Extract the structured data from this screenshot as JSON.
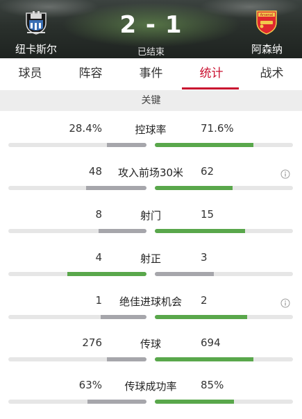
{
  "match": {
    "home_team": "纽卡斯尔",
    "away_team": "阿森纳",
    "score": "2 - 1",
    "status": "已结束",
    "home_crest_icon": "newcastle-crest-icon",
    "away_crest_icon": "arsenal-crest-icon",
    "away_crest_text": "Arsenal"
  },
  "tabs": [
    {
      "label": "球员",
      "active": false
    },
    {
      "label": "阵容",
      "active": false
    },
    {
      "label": "事件",
      "active": false
    },
    {
      "label": "统计",
      "active": true
    },
    {
      "label": "战术",
      "active": false
    }
  ],
  "section": {
    "title": "关键"
  },
  "colors": {
    "accent": "#c9102f",
    "bar_leading": "#59a74b",
    "bar_trailing": "#a6a6ab",
    "bar_track": "#e6e6e6"
  },
  "stats": [
    {
      "label": "控球率",
      "home": "28.4%",
      "away": "71.6%",
      "home_share": 0.284,
      "away_share": 0.716,
      "leader": "away",
      "info": false
    },
    {
      "label": "攻入前场30米",
      "home": "48",
      "away": "62",
      "home_share": 0.436,
      "away_share": 0.564,
      "leader": "away",
      "info": true
    },
    {
      "label": "射门",
      "home": "8",
      "away": "15",
      "home_share": 0.348,
      "away_share": 0.652,
      "leader": "away",
      "info": false
    },
    {
      "label": "射正",
      "home": "4",
      "away": "3",
      "home_share": 0.571,
      "away_share": 0.429,
      "leader": "home",
      "info": false
    },
    {
      "label": "绝佳进球机会",
      "home": "1",
      "away": "2",
      "home_share": 0.333,
      "away_share": 0.667,
      "leader": "away",
      "info": true
    },
    {
      "label": "传球",
      "home": "276",
      "away": "694",
      "home_share": 0.285,
      "away_share": 0.715,
      "leader": "away",
      "info": false
    },
    {
      "label": "传球成功率",
      "home": "63%",
      "away": "85%",
      "home_share": 0.426,
      "away_share": 0.574,
      "leader": "away",
      "info": false
    }
  ]
}
